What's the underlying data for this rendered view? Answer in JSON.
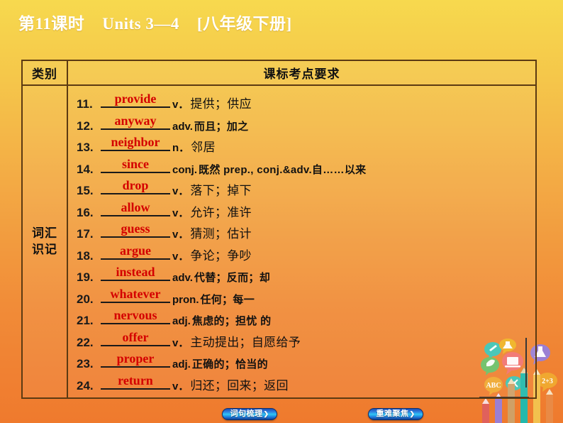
{
  "slide": {
    "title": "第11课时    Units 3—4    [八年级下册]",
    "background_top_color": "#f7d94e",
    "background_bottom_color": "#ef7a2d"
  },
  "table": {
    "headers": {
      "category": "类别",
      "requirement": "课标考点要求"
    },
    "category_label": "词汇\n识记",
    "word_color": "#d40000",
    "rows": [
      {
        "num": "11.",
        "word": "provide",
        "pos": "v．",
        "meaning": "提供；供应"
      },
      {
        "num": "12.",
        "word": "anyway",
        "pos": "adv.",
        "meaning": "而且；加之"
      },
      {
        "num": "13.",
        "word": "neighbor",
        "pos": "n．",
        "meaning": "邻居"
      },
      {
        "num": "14.",
        "word": "since",
        "pos": "conj.",
        "meaning": "既然   prep., conj.&adv.自……以来"
      },
      {
        "num": "15.",
        "word": "drop",
        "pos": "v．",
        "meaning": "落下；掉下"
      },
      {
        "num": "16.",
        "word": "allow",
        "pos": "v．",
        "meaning": "允许；准许"
      },
      {
        "num": "17.",
        "word": "guess",
        "pos": "v．",
        "meaning": "猜测；估计"
      },
      {
        "num": "18.",
        "word": "argue",
        "pos": "v．",
        "meaning": "争论；争吵"
      },
      {
        "num": "19.",
        "word": "instead",
        "pos": "adv.",
        "meaning": "代替；反而；却"
      },
      {
        "num": "20.",
        "word": "whatever",
        "pos": "pron.",
        "meaning": "任何；每一"
      },
      {
        "num": "21.",
        "word": "nervous",
        "pos": "adj.",
        "meaning": "焦虑的；担忧 的"
      },
      {
        "num": "22.",
        "word": "offer",
        "pos": "v．",
        "meaning": "主动提出；自愿给予"
      },
      {
        "num": "23.",
        "word": "proper",
        "pos": "adj.",
        "meaning": "正确的；恰当的"
      },
      {
        "num": "24.",
        "word": "return",
        "pos": "v．",
        "meaning": "归还；回来；返回"
      }
    ]
  },
  "nav": {
    "left_button": "词句梳理",
    "left_arrow": "❯",
    "right_button": "重难聚焦",
    "right_arrow": "❯"
  }
}
